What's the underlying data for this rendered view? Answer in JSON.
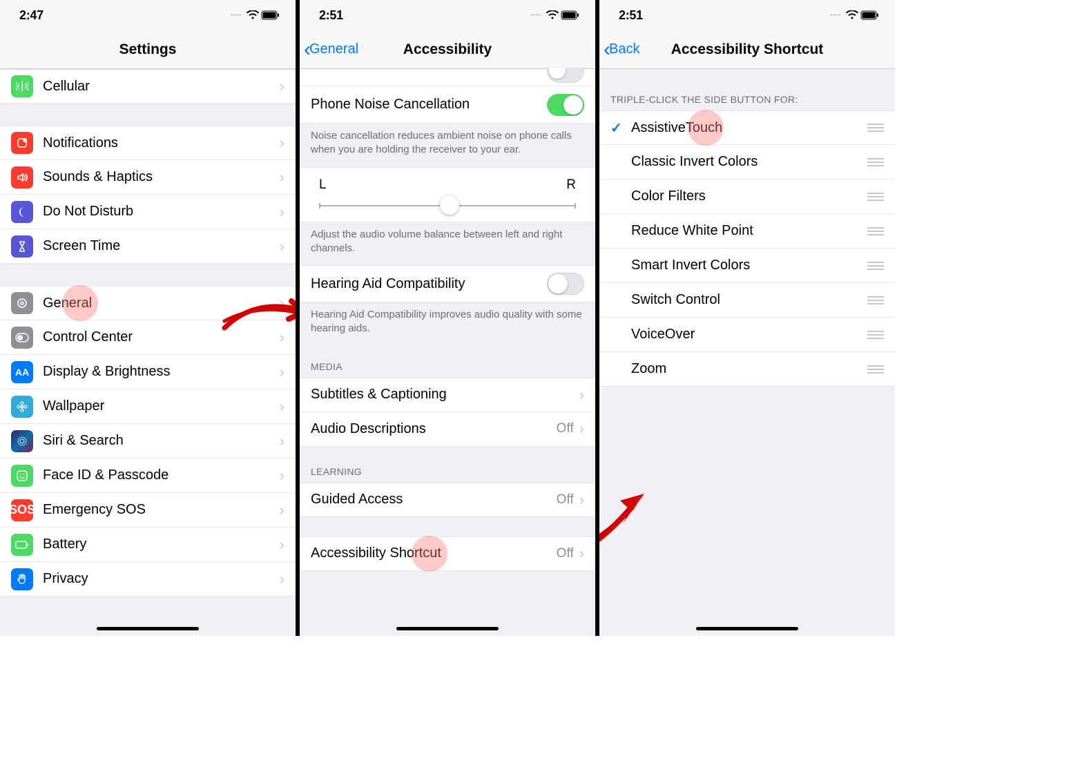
{
  "phone1": {
    "time": "2:47",
    "title": "Settings",
    "items": {
      "cellular": "Cellular",
      "notifications": "Notifications",
      "sounds": "Sounds & Haptics",
      "dnd": "Do Not Disturb",
      "screentime": "Screen Time",
      "general": "General",
      "control": "Control Center",
      "display": "Display & Brightness",
      "wallpaper": "Wallpaper",
      "siri": "Siri & Search",
      "faceid": "Face ID & Passcode",
      "sos": "Emergency SOS",
      "battery": "Battery",
      "privacy": "Privacy"
    }
  },
  "phone2": {
    "time": "2:51",
    "back": "General",
    "title": "Accessibility",
    "noise_label": "Phone Noise Cancellation",
    "noise_footer": "Noise cancellation reduces ambient noise on phone calls when you are holding the receiver to your ear.",
    "balance_left": "L",
    "balance_right": "R",
    "balance_footer": "Adjust the audio volume balance between left and right channels.",
    "hearing_label": "Hearing Aid Compatibility",
    "hearing_footer": "Hearing Aid Compatibility improves audio quality with some hearing aids.",
    "media_header": "MEDIA",
    "subtitles": "Subtitles & Captioning",
    "audiodesc": "Audio Descriptions",
    "audiodesc_val": "Off",
    "learning_header": "LEARNING",
    "guided": "Guided Access",
    "guided_val": "Off",
    "shortcut": "Accessibility Shortcut",
    "shortcut_val": "Off"
  },
  "phone3": {
    "time": "2:51",
    "back": "Back",
    "title": "Accessibility Shortcut",
    "header": "TRIPLE-CLICK THE SIDE BUTTON FOR:",
    "items": [
      "AssistiveTouch",
      "Classic Invert Colors",
      "Color Filters",
      "Reduce White Point",
      "Smart Invert Colors",
      "Switch Control",
      "VoiceOver",
      "Zoom"
    ]
  }
}
